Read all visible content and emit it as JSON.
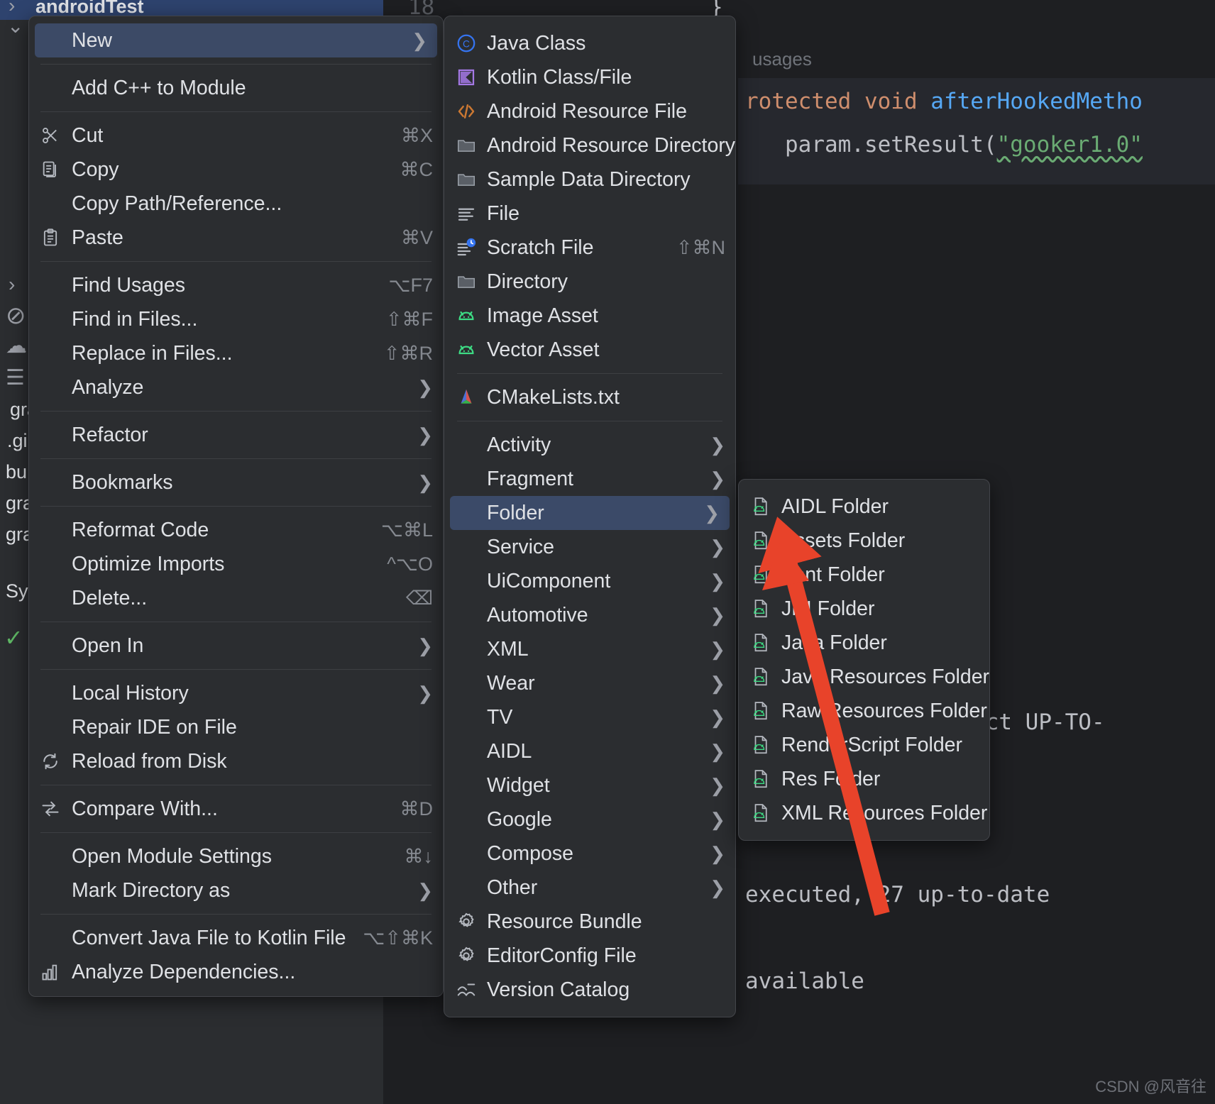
{
  "editor": {
    "project_tree": [
      {
        "label": "androidTest",
        "icon": "folder-green-icon",
        "selected": true
      },
      {
        "label": "gra",
        "icon": "file-icon"
      },
      {
        "label": ".gi",
        "icon": "file-icon"
      },
      {
        "label": "bu",
        "icon": "kotlin-icon"
      },
      {
        "label": "gra",
        "icon": "file-icon"
      },
      {
        "label": "gra",
        "icon": "file-icon"
      },
      {
        "label": "Sy",
        "icon": "none"
      }
    ],
    "gutter_line_number": "18",
    "hint_usages": "usages",
    "code_lines": [
      "rotected void afterHookedMetho",
      "   param.setResult(\"gooker1.0\""
    ],
    "code_tail": "}",
    "console_lines": [
      "ect UP-TO-",
      "executed, 27 up-to-date",
      "available"
    ]
  },
  "watermark": "CSDN @风音往",
  "context_menu": {
    "name": "file-context-menu",
    "items": [
      {
        "label": "New",
        "icon": "none",
        "shortcut": "",
        "submenu": true,
        "selected": true
      },
      {
        "type": "separator"
      },
      {
        "label": "Add C++ to Module",
        "icon": "none",
        "shortcut": "",
        "submenu": false
      },
      {
        "type": "separator"
      },
      {
        "label": "Cut",
        "icon": "scissors-icon",
        "shortcut": "⌘X",
        "submenu": false
      },
      {
        "label": "Copy",
        "icon": "copy-icon",
        "shortcut": "⌘C",
        "submenu": false
      },
      {
        "label": "Copy Path/Reference...",
        "icon": "none",
        "shortcut": "",
        "submenu": false
      },
      {
        "label": "Paste",
        "icon": "paste-icon",
        "shortcut": "⌘V",
        "submenu": false
      },
      {
        "type": "separator"
      },
      {
        "label": "Find Usages",
        "icon": "none",
        "shortcut": "⌥F7",
        "submenu": false
      },
      {
        "label": "Find in Files...",
        "icon": "none",
        "shortcut": "⇧⌘F",
        "submenu": false
      },
      {
        "label": "Replace in Files...",
        "icon": "none",
        "shortcut": "⇧⌘R",
        "submenu": false
      },
      {
        "label": "Analyze",
        "icon": "none",
        "shortcut": "",
        "submenu": true
      },
      {
        "type": "separator"
      },
      {
        "label": "Refactor",
        "icon": "none",
        "shortcut": "",
        "submenu": true
      },
      {
        "type": "separator"
      },
      {
        "label": "Bookmarks",
        "icon": "none",
        "shortcut": "",
        "submenu": true
      },
      {
        "type": "separator"
      },
      {
        "label": "Reformat Code",
        "icon": "none",
        "shortcut": "⌥⌘L",
        "submenu": false
      },
      {
        "label": "Optimize Imports",
        "icon": "none",
        "shortcut": "^⌥O",
        "submenu": false
      },
      {
        "label": "Delete...",
        "icon": "none",
        "shortcut": "⌫",
        "submenu": false
      },
      {
        "type": "separator"
      },
      {
        "label": "Open In",
        "icon": "none",
        "shortcut": "",
        "submenu": true
      },
      {
        "type": "separator"
      },
      {
        "label": "Local History",
        "icon": "none",
        "shortcut": "",
        "submenu": true
      },
      {
        "label": "Repair IDE on File",
        "icon": "none",
        "shortcut": "",
        "submenu": false
      },
      {
        "label": "Reload from Disk",
        "icon": "reload-icon",
        "shortcut": "",
        "submenu": false
      },
      {
        "type": "separator"
      },
      {
        "label": "Compare With...",
        "icon": "compare-icon",
        "shortcut": "⌘D",
        "submenu": false
      },
      {
        "type": "separator"
      },
      {
        "label": "Open Module Settings",
        "icon": "none",
        "shortcut": "⌘↓",
        "submenu": false
      },
      {
        "label": "Mark Directory as",
        "icon": "none",
        "shortcut": "",
        "submenu": true
      },
      {
        "type": "separator"
      },
      {
        "label": "Convert Java File to Kotlin File",
        "icon": "none",
        "shortcut": "⌥⇧⌘K",
        "submenu": false
      },
      {
        "label": "Analyze Dependencies...",
        "icon": "dependencies-icon",
        "shortcut": "",
        "submenu": false
      }
    ]
  },
  "new_menu": {
    "name": "new-submenu",
    "items": [
      {
        "label": "Java Class",
        "icon": "java-class-icon",
        "shortcut": "",
        "submenu": false
      },
      {
        "label": "Kotlin Class/File",
        "icon": "kotlin-class-icon",
        "shortcut": "",
        "submenu": false
      },
      {
        "label": "Android Resource File",
        "icon": "xml-tag-icon",
        "shortcut": "",
        "submenu": false
      },
      {
        "label": "Android Resource Directory",
        "icon": "folder-icon",
        "shortcut": "",
        "submenu": false
      },
      {
        "label": "Sample Data Directory",
        "icon": "folder-icon",
        "shortcut": "",
        "submenu": false
      },
      {
        "label": "File",
        "icon": "file-lines-icon",
        "shortcut": "",
        "submenu": false
      },
      {
        "label": "Scratch File",
        "icon": "scratch-file-icon",
        "shortcut": "⇧⌘N",
        "submenu": false
      },
      {
        "label": "Directory",
        "icon": "folder-icon",
        "shortcut": "",
        "submenu": false
      },
      {
        "label": "Image Asset",
        "icon": "android-icon",
        "shortcut": "",
        "submenu": false
      },
      {
        "label": "Vector Asset",
        "icon": "android-icon",
        "shortcut": "",
        "submenu": false
      },
      {
        "type": "separator"
      },
      {
        "label": "CMakeLists.txt",
        "icon": "cmake-icon",
        "shortcut": "",
        "submenu": false
      },
      {
        "type": "separator"
      },
      {
        "label": "Activity",
        "icon": "none",
        "shortcut": "",
        "submenu": true
      },
      {
        "label": "Fragment",
        "icon": "none",
        "shortcut": "",
        "submenu": true
      },
      {
        "label": "Folder",
        "icon": "none",
        "shortcut": "",
        "submenu": true,
        "selected": true
      },
      {
        "label": "Service",
        "icon": "none",
        "shortcut": "",
        "submenu": true
      },
      {
        "label": "UiComponent",
        "icon": "none",
        "shortcut": "",
        "submenu": true
      },
      {
        "label": "Automotive",
        "icon": "none",
        "shortcut": "",
        "submenu": true
      },
      {
        "label": "XML",
        "icon": "none",
        "shortcut": "",
        "submenu": true
      },
      {
        "label": "Wear",
        "icon": "none",
        "shortcut": "",
        "submenu": true
      },
      {
        "label": "TV",
        "icon": "none",
        "shortcut": "",
        "submenu": true
      },
      {
        "label": "AIDL",
        "icon": "none",
        "shortcut": "",
        "submenu": true
      },
      {
        "label": "Widget",
        "icon": "none",
        "shortcut": "",
        "submenu": true
      },
      {
        "label": "Google",
        "icon": "none",
        "shortcut": "",
        "submenu": true
      },
      {
        "label": "Compose",
        "icon": "none",
        "shortcut": "",
        "submenu": true
      },
      {
        "label": "Other",
        "icon": "none",
        "shortcut": "",
        "submenu": true
      },
      {
        "label": "Resource Bundle",
        "icon": "gear-icon",
        "shortcut": "",
        "submenu": false
      },
      {
        "label": "EditorConfig File",
        "icon": "gear-icon",
        "shortcut": "",
        "submenu": false
      },
      {
        "label": "Version Catalog",
        "icon": "catalog-icon",
        "shortcut": "",
        "submenu": false
      }
    ]
  },
  "folder_menu": {
    "name": "folder-submenu",
    "items": [
      {
        "label": "AIDL Folder",
        "icon": "android-folder-icon"
      },
      {
        "label": "Assets Folder",
        "icon": "android-folder-icon"
      },
      {
        "label": "Font Folder",
        "icon": "android-folder-icon"
      },
      {
        "label": "JNI Folder",
        "icon": "android-folder-icon"
      },
      {
        "label": "Java Folder",
        "icon": "android-folder-icon"
      },
      {
        "label": "Java Resources Folder",
        "icon": "android-folder-icon"
      },
      {
        "label": "Raw Resources Folder",
        "icon": "android-folder-icon"
      },
      {
        "label": "RenderScript Folder",
        "icon": "android-folder-icon"
      },
      {
        "label": "Res Folder",
        "icon": "android-folder-icon"
      },
      {
        "label": "XML Resources Folder",
        "icon": "android-folder-icon"
      }
    ]
  },
  "annotation": {
    "name": "red-arrow-annotation",
    "color": "#E8432A",
    "points": "from (1240,1285) to (1108,768)"
  },
  "colors": {
    "menu_bg": "#2b2d30",
    "menu_border": "#43454a",
    "highlight": "#3b4a68",
    "text": "#dfe1e5",
    "shortcut_text": "#868a91",
    "editor_bg": "#1e1f22",
    "accent_green": "#3ddc84",
    "accent_blue": "#56a8f5",
    "accent_orange": "#cf8e6d",
    "accent_purple": "#a579e6",
    "arrow_red": "#E8432A"
  }
}
